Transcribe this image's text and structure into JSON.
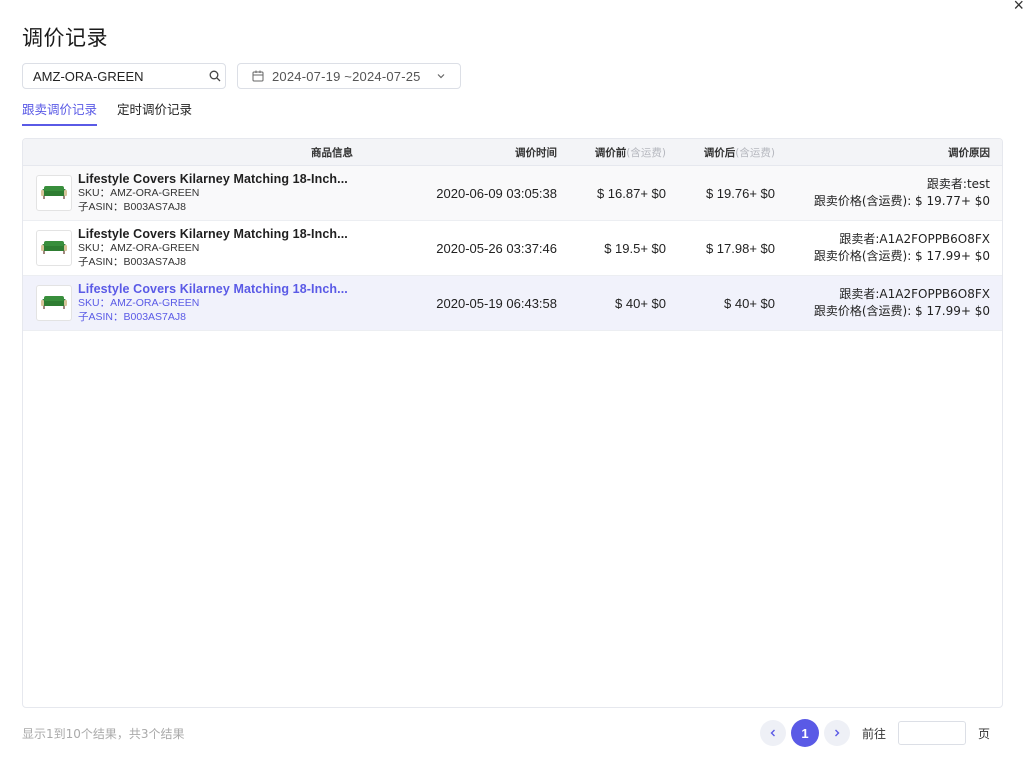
{
  "title": "调价记录",
  "close_label": "×",
  "search": {
    "value": "AMZ-ORA-GREEN"
  },
  "date_range": {
    "value": "2024-07-19 ~2024-07-25"
  },
  "tabs": [
    {
      "label": "跟卖调价记录",
      "active": true
    },
    {
      "label": "定时调价记录",
      "active": false
    }
  ],
  "table": {
    "headers": {
      "product": "商品信息",
      "time": "调价时间",
      "before": "调价前",
      "before_note": "(含运费)",
      "after": "调价后",
      "after_note": "(含运费)",
      "reason": "调价原因"
    },
    "rows": [
      {
        "name": "Lifestyle Covers Kilarney Matching 18-Inch...",
        "sku": "SKU：AMZ-ORA-GREEN",
        "asin": "子ASIN：B003AS7AJ8",
        "time": "2020-06-09 03:05:38",
        "before": "$ 16.87+ $0",
        "after": "$ 19.76+ $0",
        "reason_line1": "跟卖者:test",
        "reason_line2": "跟卖价格(含运费): $ 19.77+ $0"
      },
      {
        "name": "Lifestyle Covers Kilarney Matching 18-Inch...",
        "sku": "SKU：AMZ-ORA-GREEN",
        "asin": "子ASIN：B003AS7AJ8",
        "time": "2020-05-26 03:37:46",
        "before": "$ 19.5+ $0",
        "after": "$ 17.98+ $0",
        "reason_line1": "跟卖者:A1A2FOPPB6O8FX",
        "reason_line2": "跟卖价格(含运费): $ 17.99+ $0"
      },
      {
        "name": "Lifestyle Covers Kilarney Matching 18-Inch...",
        "sku": "SKU：AMZ-ORA-GREEN",
        "asin": "子ASIN：B003AS7AJ8",
        "time": "2020-05-19 06:43:58",
        "before": "$ 40+ $0",
        "after": "$ 40+ $0",
        "reason_line1": "跟卖者:A1A2FOPPB6O8FX",
        "reason_line2": "跟卖价格(含运费): $ 17.99+ $0"
      }
    ]
  },
  "footer": {
    "summary": "显示1到10个结果，共3个结果",
    "current_page": "1",
    "goto_label": "前往",
    "page_label": "页"
  },
  "colors": {
    "accent": "#5a5ae6",
    "header_bg": "#f3f4f7",
    "highlight_row": "#f1f2fb"
  }
}
